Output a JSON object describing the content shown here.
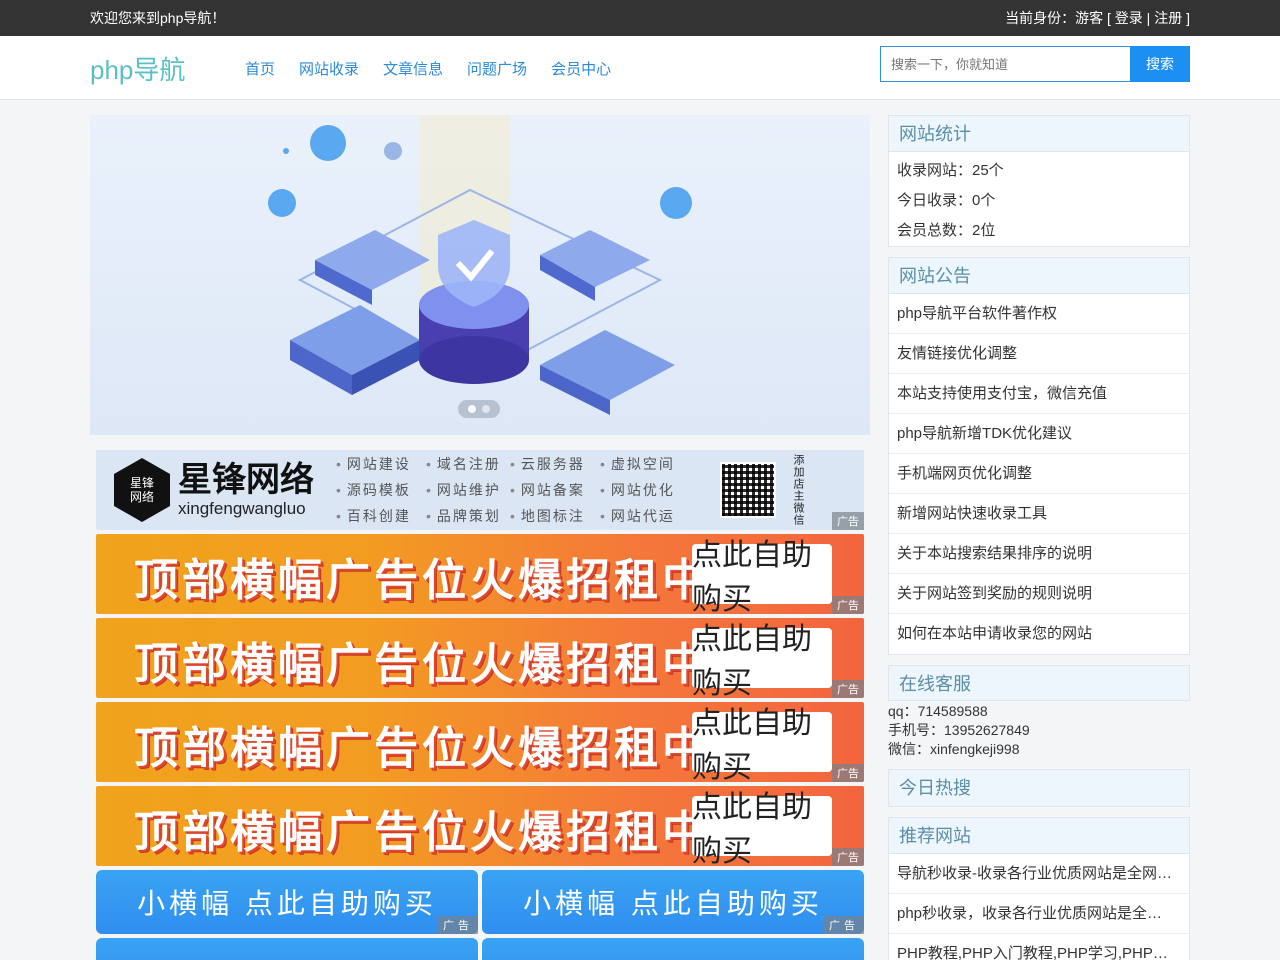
{
  "topbar": {
    "welcome": "欢迎您来到php导航！",
    "identity_prefix": "当前身份：游客 [ ",
    "login": "登录",
    "sep": " | ",
    "register": "注册",
    "suffix": " ]"
  },
  "header": {
    "logo": "php导航",
    "nav": [
      "首页",
      "网站收录",
      "文章信息",
      "问题广场",
      "会员中心"
    ],
    "search_placeholder": "搜索一下，你就知道",
    "search_button": "搜索"
  },
  "ads": {
    "xingfeng": {
      "badge": "星锋网络",
      "name_cn": "星锋网络",
      "name_en": "xingfengwangluo",
      "services": [
        "网站建设",
        "域名注册",
        "云服务器",
        "虚拟空间",
        "源码模板",
        "网站维护",
        "网站备案",
        "网站优化",
        "百科创建",
        "品牌策划",
        "地图标注",
        "网站代运"
      ],
      "qr_text": "添加店主微信",
      "tag": "广告"
    },
    "big": [
      {
        "title": "顶部横幅广告位火爆招租中……",
        "button": "点此自助购买",
        "tag": "广告"
      },
      {
        "title": "顶部横幅广告位火爆招租中……",
        "button": "点此自助购买",
        "tag": "广告"
      },
      {
        "title": "顶部横幅广告位火爆招租中……",
        "button": "点此自助购买",
        "tag": "广告"
      },
      {
        "title": "顶部横幅广告位火爆招租中……",
        "button": "点此自助购买",
        "tag": "广告"
      }
    ],
    "small": [
      {
        "text": "小横幅 点此自助购买",
        "tag": "广告"
      },
      {
        "text": "小横幅 点此自助购买",
        "tag": "广告"
      }
    ]
  },
  "sidebar": {
    "stats": {
      "title": "网站统计",
      "items": [
        "收录网站：25个",
        "今日收录：0个",
        "会员总数：2位"
      ]
    },
    "notice": {
      "title": "网站公告",
      "items": [
        "php导航平台软件著作权",
        "友情链接优化调整",
        "本站支持使用支付宝，微信充值",
        "php导航新增TDK优化建议",
        "手机端网页优化调整",
        "新增网站快速收录工具",
        "关于本站搜索结果排序的说明",
        "关于网站签到奖励的规则说明",
        "如何在本站申请收录您的网站"
      ]
    },
    "service": {
      "title": "在线客服",
      "items": [
        "qq：714589588",
        "手机号：13952627849",
        "微信：xinfengkeji998"
      ]
    },
    "hot": {
      "title": "今日热搜"
    },
    "recommend": {
      "title": "推荐网站",
      "items": [
        "导航秒收录-收录各行业优质网站是全网最全面的网站",
        "php秒收录，收录各行业优质网站是全网最全面",
        "PHP教程,PHP入门教程,PHP学习,PHP开发"
      ]
    }
  }
}
